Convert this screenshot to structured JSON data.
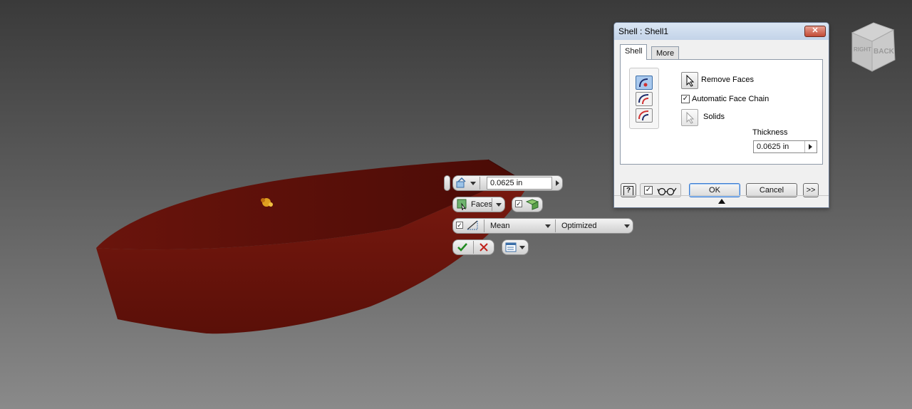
{
  "viewcube": {
    "face_back": "BACK",
    "face_right": "RIGHT"
  },
  "minitoolbar": {
    "thickness_value": "0.0625 in",
    "faces_label": "Faces",
    "mode_label": "Mean",
    "quality_label": "Optimized",
    "auto_chain_checked": true,
    "options_checked": true
  },
  "dialog": {
    "title": "Shell : Shell1",
    "close_label": "✕",
    "tabs": [
      {
        "label": "Shell"
      },
      {
        "label": "More"
      }
    ],
    "remove_faces_label": "Remove Faces",
    "automatic_face_chain_label": "Automatic Face Chain",
    "automatic_face_chain_checked": true,
    "solids_label": "Solids",
    "thickness_label": "Thickness",
    "thickness_value": "0.0625 in",
    "ok_label": "OK",
    "cancel_label": "Cancel",
    "more_label": ">>",
    "help_label": "?",
    "preview_checked": true
  },
  "colors": {
    "boat_red": "#6a140c",
    "accent_blue": "#3c6fa8",
    "background_dark": "#3a3a3a"
  }
}
